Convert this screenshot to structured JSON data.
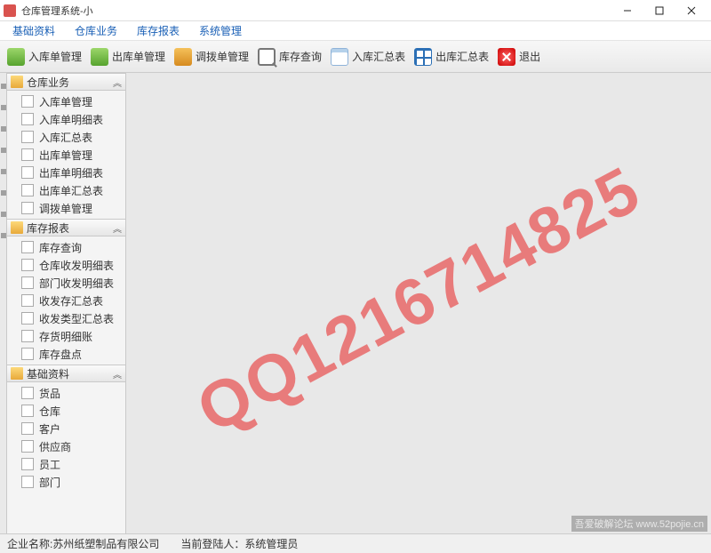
{
  "window": {
    "title": "仓库管理系统-小"
  },
  "menubar": [
    "基础资料",
    "仓库业务",
    "库存报表",
    "系统管理"
  ],
  "toolbar": [
    {
      "label": "入库单管理",
      "icon": "ic-green"
    },
    {
      "label": "出库单管理",
      "icon": "ic-green"
    },
    {
      "label": "调拨单管理",
      "icon": "ic-orange"
    },
    {
      "label": "库存查询",
      "icon": "ic-search"
    },
    {
      "label": "入库汇总表",
      "icon": "ic-sheet"
    },
    {
      "label": "出库汇总表",
      "icon": "ic-table"
    },
    {
      "label": "退出",
      "icon": "ic-red"
    }
  ],
  "sidebar": {
    "panels": [
      {
        "title": "仓库业务",
        "items": [
          "入库单管理",
          "入库单明细表",
          "入库汇总表",
          "出库单管理",
          "出库单明细表",
          "出库单汇总表",
          "调拨单管理"
        ]
      },
      {
        "title": "库存报表",
        "items": [
          "库存查询",
          "仓库收发明细表",
          "部门收发明细表",
          "收发存汇总表",
          "收发类型汇总表",
          "存货明细账",
          "库存盘点"
        ]
      },
      {
        "title": "基础资料",
        "items": [
          "货品",
          "仓库",
          "客户",
          "供应商",
          "员工",
          "部门"
        ]
      }
    ]
  },
  "status": {
    "company_label": "企业名称:",
    "company_value": "苏州纸塑制品有限公司",
    "user_label": "当前登陆人：",
    "user_value": "系统管理员"
  },
  "watermark": "QQ1216714825",
  "corner_mark": "吾爱破解论坛 www.52pojie.cn"
}
